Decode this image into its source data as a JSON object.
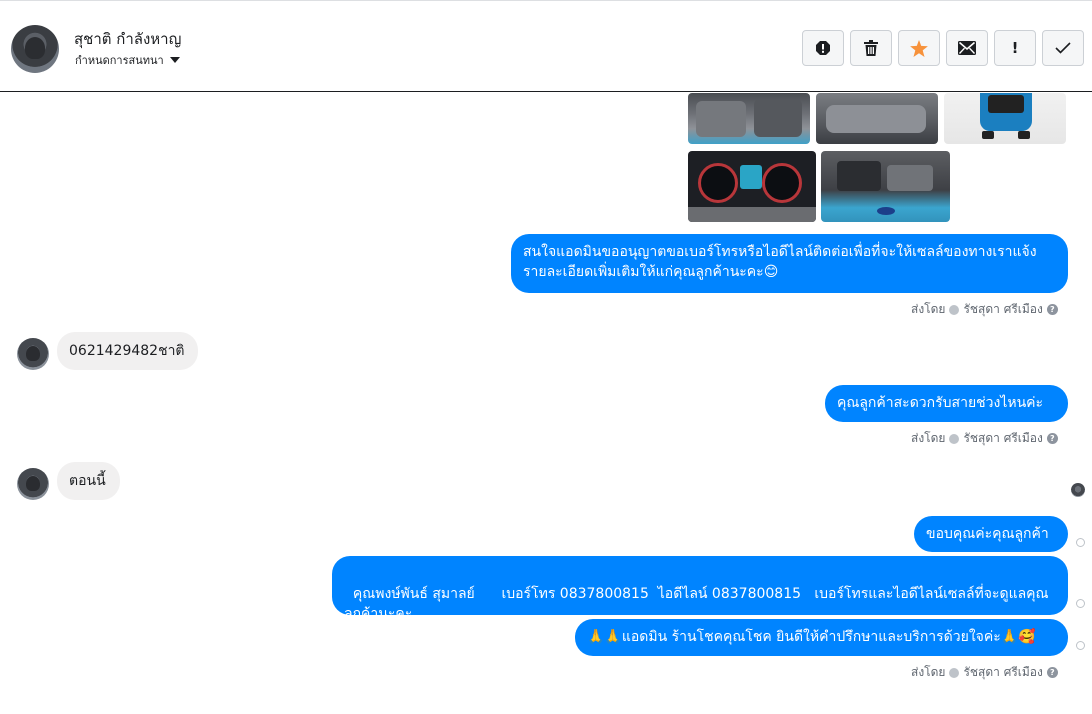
{
  "header": {
    "user_name": "สุชาติ กำลังหาญ",
    "assign_label": "กำหนดการสนทนา",
    "actions": [
      "alert-icon",
      "trash-icon",
      "star-icon",
      "envelope-icon",
      "exclamation-icon",
      "check-icon"
    ],
    "exclamation_glyph": "!"
  },
  "colors": {
    "outgoing_bubble": "#0084ff",
    "incoming_bubble": "#f1f0f0",
    "star": "#f7923b"
  },
  "messages": {
    "m1": "สนใจแอดมินขออนุญาตขอเบอร์โทรหรือไอดีไลน์ติดต่อเพื่อที่จะให้เซลล์ของทางเราแจ้งรายละเอียดเพิ่มเติมให้แก่คุณลูกค้านะคะ😊",
    "m2": "0621429482ชาติ",
    "m3": "คุณลูกค้าสะดวกรับสายช่วงไหนค่ะ",
    "m4": "ตอนนี้",
    "m5": "ขอบคุณค่ะคุณลูกค้า",
    "m6": "คุณพงษ์พันธ์ สุมาลย์      เบอร์โทร 0837800815  ไอดีไลน์ 0837800815   เบอร์โทรและไอดีไลน์เซลล์ที่จะดูแลคุณลูกค้านะคะ",
    "m7": "🙏🙏แอดมิน ร้านโชคคุณโชค ยินดีให้คำปรึกษาและบริการด้วยใจค่ะ🙏🥰"
  },
  "sent_by": {
    "prefix": "ส่งโดย",
    "agent": "รัชสุดา ศรีเมือง",
    "help": "?"
  }
}
